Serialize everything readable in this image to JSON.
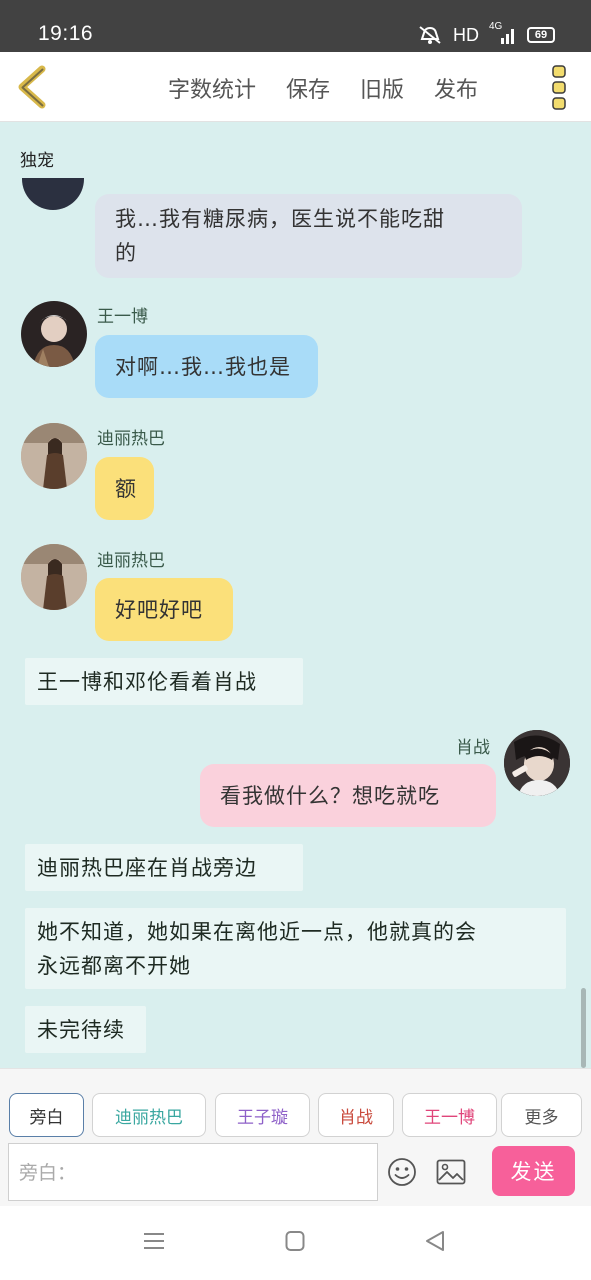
{
  "status_bar": {
    "time": "19:16",
    "network": "HD",
    "signal_label": "4G",
    "battery": "69"
  },
  "toolbar": {
    "actions": [
      "字数统计",
      "保存",
      "旧版",
      "发布"
    ]
  },
  "chat": {
    "title": "独宠",
    "messages": [
      {
        "type": "bubble",
        "sender": "",
        "text": "我…我有糖尿病，医生说不能吃甜的",
        "lines": [
          "我…我有糖尿病，医生说不能吃甜",
          "的"
        ],
        "color": "#dde3ec"
      },
      {
        "type": "bubble",
        "sender": "王一博",
        "text": "对啊…我…我也是",
        "color": "#a9dcf8"
      },
      {
        "type": "bubble",
        "sender": "迪丽热巴",
        "text": "额",
        "color": "#fbe07a"
      },
      {
        "type": "bubble",
        "sender": "迪丽热巴",
        "text": "好吧好吧",
        "color": "#fbe07a"
      },
      {
        "type": "narration",
        "text": "王一博和邓伦看着肖战"
      },
      {
        "type": "bubble",
        "sender": "肖战",
        "text": "看我做什么？想吃就吃",
        "color": "#fad1dc",
        "align": "right"
      },
      {
        "type": "narration",
        "text": "迪丽热巴座在肖战旁边"
      },
      {
        "type": "narration",
        "text": "她不知道，她如果在离他近一点，他就真的会永远都离不开她",
        "lines": [
          "她不知道，她如果在离他近一点，他就真的会",
          "永远都离不开她"
        ]
      },
      {
        "type": "narration",
        "text": "未完待续"
      }
    ]
  },
  "roles": [
    {
      "label": "旁白",
      "color": "#333333",
      "active": true
    },
    {
      "label": "迪丽热巴",
      "color": "#3aa7a0"
    },
    {
      "label": "王子璇",
      "color": "#8e60c8"
    },
    {
      "label": "肖战",
      "color": "#c94a3c"
    },
    {
      "label": "王一博",
      "color": "#e0457a"
    },
    {
      "label": "更多",
      "color": "#555555"
    }
  ],
  "composer": {
    "placeholder": "旁白：",
    "send_label": "发送"
  },
  "colors": {
    "accent": "#f7609a",
    "chat_bg": "#d9efee",
    "back_arrow": "#d8b84a"
  }
}
